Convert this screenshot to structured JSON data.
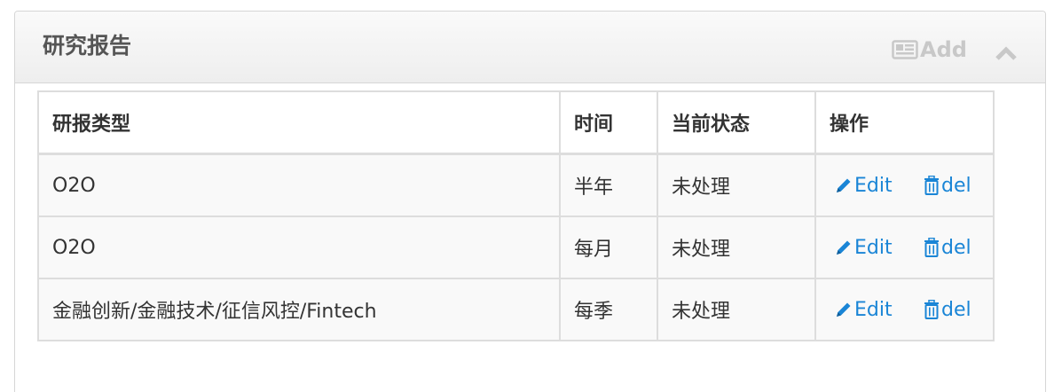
{
  "panel": {
    "title": "研究报告",
    "add_label": "Add",
    "add_icon": "newspaper-icon",
    "collapse_icon": "chevron-up-icon"
  },
  "table": {
    "headers": [
      "研报类型",
      "时间",
      "当前状态",
      "操作"
    ],
    "rows": [
      {
        "type": "O2O",
        "time": "半年",
        "status": "未处理",
        "edit_label": "Edit",
        "del_label": "del"
      },
      {
        "type": "O2O",
        "time": "每月",
        "status": "未处理",
        "edit_label": "Edit",
        "del_label": "del"
      },
      {
        "type": "金融创新/金融技术/征信风控/Fintech",
        "time": "每季",
        "status": "未处理",
        "edit_label": "Edit",
        "del_label": "del"
      }
    ],
    "edit_icon": "pencil-icon",
    "del_icon": "trash-icon"
  },
  "colors": {
    "link": "#1a85d6",
    "header_text": "#555555",
    "add_disabled": "#c8c8c8",
    "row_bg": "#f9f9f9",
    "border": "#dddddd"
  }
}
